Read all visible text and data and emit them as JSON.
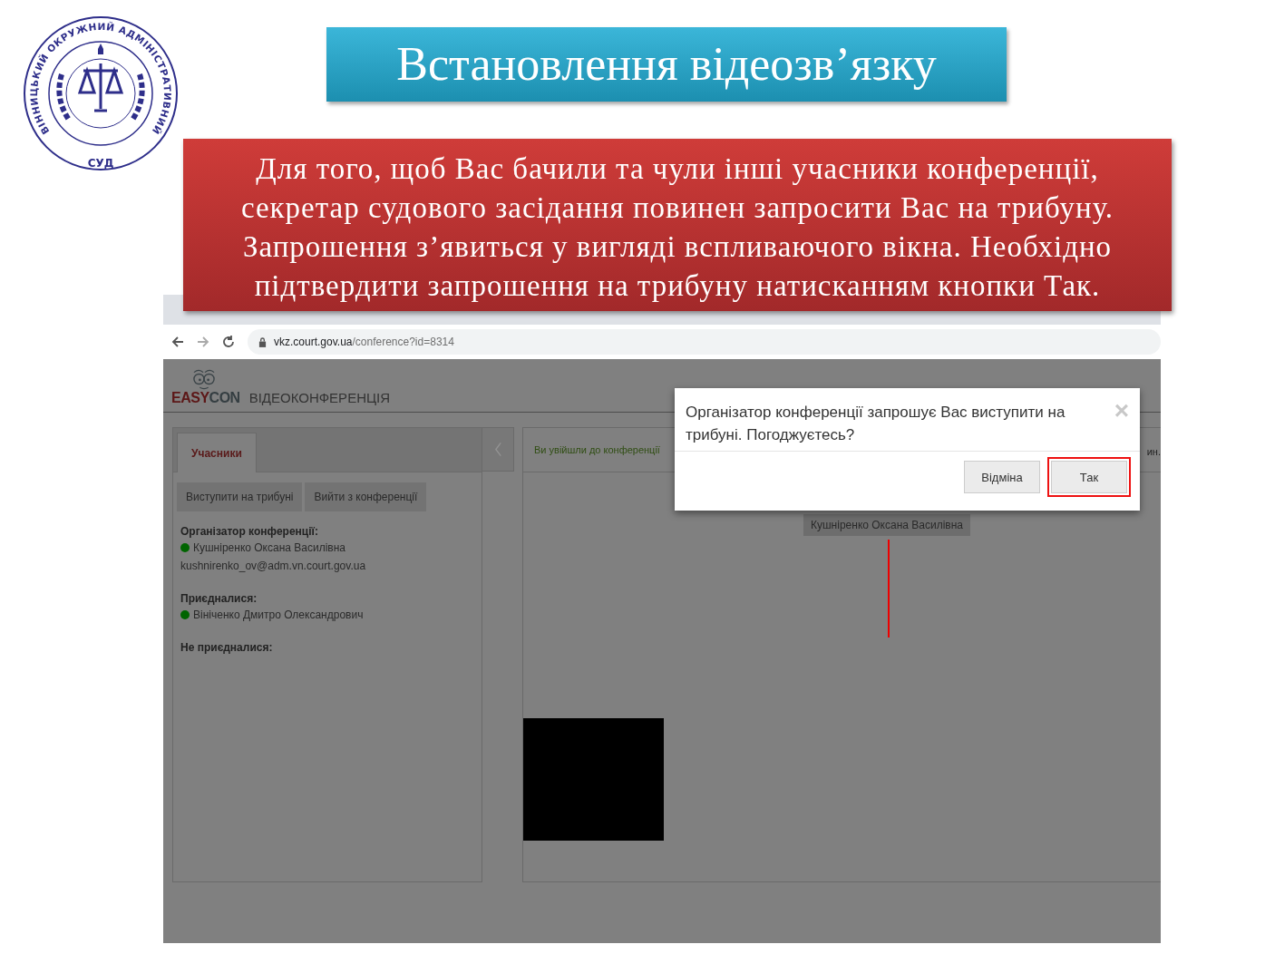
{
  "logo": {
    "ring_text": "ВІННИЦЬКИЙ ОКРУЖНИЙ АДМІНІСТРАТИВНИЙ",
    "bottom_text": "СУД"
  },
  "slide": {
    "title": "Встановлення відеозв’язку",
    "note": "Для того, щоб Вас бачили та чули інші учасники конференції, секретар судового засідання повинен запросити Вас на трибуну. Запрошення з’явиться у вигляді вспливаючого вікна. Необхідно підтвердити запрошення на трибуну натисканням кнопки Так."
  },
  "browser": {
    "url_host": "vkz.court.gov.ua",
    "url_path": "/conference?id=8314"
  },
  "app": {
    "brand": {
      "part_1": "EASY",
      "part_2": "CON"
    },
    "title": "ВІДЕОКОНФЕРЕНЦІЯ"
  },
  "tabs": [
    {
      "label": "Учасники",
      "selected": true
    }
  ],
  "actions": [
    "Виступити на трибуні",
    "Вийти з конференції"
  ],
  "sections": [
    {
      "heading": "Організатор конференції:",
      "people": [
        {
          "name": "Кушніренко Оксана Василівна",
          "color": "#006400",
          "email": "kushnirenko_ov@adm.vn.court.gov.ua"
        }
      ]
    },
    {
      "heading": "Приєдналися:",
      "people": [
        {
          "name": "Вініченко Дмитро Олександрович",
          "color": "#006400"
        }
      ]
    },
    {
      "heading": "Не приєдналися:"
    }
  ],
  "conference": {
    "status": "Ви увійшли до конференції",
    "status_cut": "ин.",
    "speaker": "Кушніренко Оксана Василівна"
  },
  "dialog": {
    "message": "Організатор конференції запрошує Вас виступити на трибуні. Погоджуєтесь?",
    "close": "×",
    "buttons": [
      {
        "label": "Відміна",
        "highlighted": false
      },
      {
        "label": "Так",
        "highlighted": true
      }
    ]
  }
}
